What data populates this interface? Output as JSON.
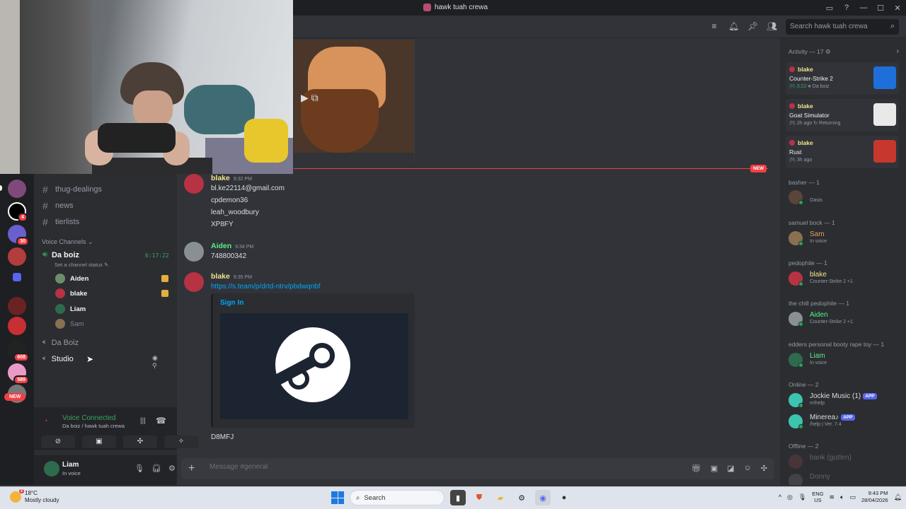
{
  "window": {
    "title": "hawk tuah crewa"
  },
  "header": {
    "search_placeholder": "Search hawk tuah crewa"
  },
  "rail": {
    "badges": [
      "4",
      "30",
      "608",
      "589"
    ],
    "new_label": "NEW"
  },
  "sidebar": {
    "text_channels": [
      "thug-dealings",
      "news",
      "tierlists"
    ],
    "voice_category": "Voice Channels",
    "voice_channel": {
      "name": "Da boiz",
      "timer": "6:17:22",
      "status": "Set a channel status"
    },
    "voice_users": [
      "Aiden",
      "blake",
      "Liam",
      "Sam"
    ],
    "other_voice": [
      "Da Boiz",
      "Studio"
    ],
    "voice_panel": {
      "title": "Voice Connected",
      "subtitle": "Da boiz / hawk tuah crewa"
    },
    "user": {
      "name": "Liam",
      "status": "In voice"
    }
  },
  "chat": {
    "new_tag": "NEW",
    "messages": [
      {
        "author": "blake",
        "time": "9:32 PM",
        "lines": [
          "bl.ke22114@gmail.com",
          "cpdemon36",
          "leah_woodbury",
          "XP8FY"
        ]
      },
      {
        "author": "Aiden",
        "time": "9:34 PM",
        "lines": [
          "748800342"
        ]
      },
      {
        "author": "blake",
        "time": "9:35 PM",
        "link": "https://s.team/p/drtd-ntrv/pbdwqnbf",
        "embed_title": "Sign In",
        "after": "D8MFJ"
      }
    ],
    "composer_placeholder": "Message #general"
  },
  "members": {
    "activity_header": "Activity — 17",
    "activity": [
      {
        "user": "blake",
        "game": "Counter-Strike 2",
        "time": "8:22",
        "extra": "Da boiz",
        "color": "#1e6fd9"
      },
      {
        "user": "blake",
        "game": "Goat Simulator",
        "time": "2h ago",
        "extra": "Returning",
        "color": "#e9e9e9"
      },
      {
        "user": "blake",
        "game": "Rust",
        "time": "3h ago",
        "extra": "",
        "color": "#c8372d"
      }
    ],
    "groups": [
      {
        "title": "basher — 1",
        "name": "",
        "sub": "Oasis",
        "color": "#dbdee1"
      },
      {
        "title": "samuel bock — 1",
        "name": "Sam",
        "sub": "In voice",
        "color": "#e6a05c"
      },
      {
        "title": "pedophile — 1",
        "name": "blake",
        "sub": "Counter-Strike 2 +1",
        "color": "#f0e68c"
      },
      {
        "title": "the chill pedophile — 1",
        "name": "Aiden",
        "sub": "Counter-Strike 2 +1",
        "color": "#57f287"
      },
      {
        "title": "edders personal booty rape toy — 1",
        "name": "Liam",
        "sub": "In voice",
        "color": "#57f287"
      }
    ],
    "online_header": "Online — 2",
    "online": [
      {
        "name": "Jockie Music (1)",
        "sub": "m!help",
        "tag": "APP"
      },
      {
        "name": "Minerea♪",
        "sub": "/help | Ver. 7.4",
        "tag": "APP"
      }
    ],
    "offline_header": "Offline — 2",
    "offline": [
      "bank (gutten)",
      "Donny"
    ]
  },
  "taskbar": {
    "weather_temp": "18°C",
    "weather_desc": "Mostly cloudy",
    "weather_badge": "3",
    "search_label": "Search",
    "lang1": "ENG",
    "lang2": "US",
    "time": "9:43 PM",
    "date": "28/04/2026"
  }
}
